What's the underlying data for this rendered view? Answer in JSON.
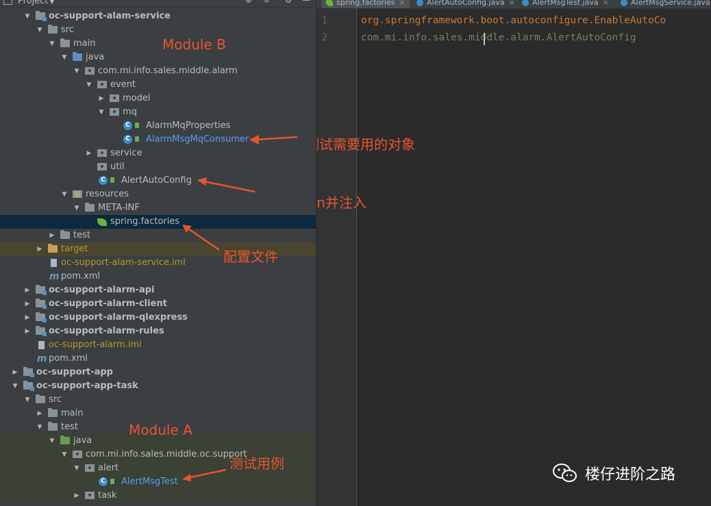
{
  "project_panel": {
    "title": "Project",
    "tree": [
      {
        "label": "oc-support-alam-service",
        "bold": true
      },
      {
        "label": "src"
      },
      {
        "label": "main"
      },
      {
        "label": "java"
      },
      {
        "label": "com.mi.info.sales.middle.alarm"
      },
      {
        "label": "event"
      },
      {
        "label": "model"
      },
      {
        "label": "mq"
      },
      {
        "label": "AlarmMqProperties"
      },
      {
        "label": "AlarmMsgMqConsumer"
      },
      {
        "label": "service"
      },
      {
        "label": "util"
      },
      {
        "label": "AlertAutoConfig"
      },
      {
        "label": "resources"
      },
      {
        "label": "META-INF"
      },
      {
        "label": "spring.factories"
      },
      {
        "label": "test"
      },
      {
        "label": "target"
      },
      {
        "label": "oc-support-alam-service.iml"
      },
      {
        "label": "pom.xml"
      },
      {
        "label": "oc-support-alarm-api",
        "bold": true
      },
      {
        "label": "oc-support-alarm-client",
        "bold": true
      },
      {
        "label": "oc-support-alarm-qlexpress",
        "bold": true
      },
      {
        "label": "oc-support-alarm-rules",
        "bold": true
      },
      {
        "label": "oc-support-alarm.iml"
      },
      {
        "label": "pom.xml"
      },
      {
        "label": "oc-support-app",
        "bold": true
      },
      {
        "label": "oc-support-app-task",
        "bold": true
      },
      {
        "label": "src"
      },
      {
        "label": "main"
      },
      {
        "label": "test"
      },
      {
        "label": "java"
      },
      {
        "label": "com.mi.info.sales.middle.oc.support"
      },
      {
        "label": "alert"
      },
      {
        "label": "AlertMsgTest"
      },
      {
        "label": "task"
      }
    ]
  },
  "editor": {
    "tabs": [
      {
        "label": "spring.factories"
      },
      {
        "label": "AlertAutoConfig.java"
      },
      {
        "label": "AlertMsgTest.java"
      },
      {
        "label": "AlertMsgService.java"
      }
    ],
    "lines": [
      {
        "no": "1",
        "text": "org.springframework.boot.autoconfigure.EnableAutoCo"
      },
      {
        "no": "2",
        "text": "com.mi.info.sales.middle.alarm.AlertAutoConfig"
      }
    ]
  },
  "annotations": {
    "module_b": "Module B",
    "module_a": "Module A",
    "test_object": "测试需要用的对象",
    "scan_bean": "扫描Bean并注入",
    "config_file": "配置文件",
    "test_case": "测试用例",
    "color": "#e8542f"
  },
  "watermark": {
    "name": "楼仔进阶之路"
  },
  "colors": {
    "panel_bg": "#3c3f41",
    "editor_bg": "#2b2b2b",
    "selection": "#0d293e",
    "keyword_orange": "#cc7832",
    "string_green": "#6a8759"
  }
}
